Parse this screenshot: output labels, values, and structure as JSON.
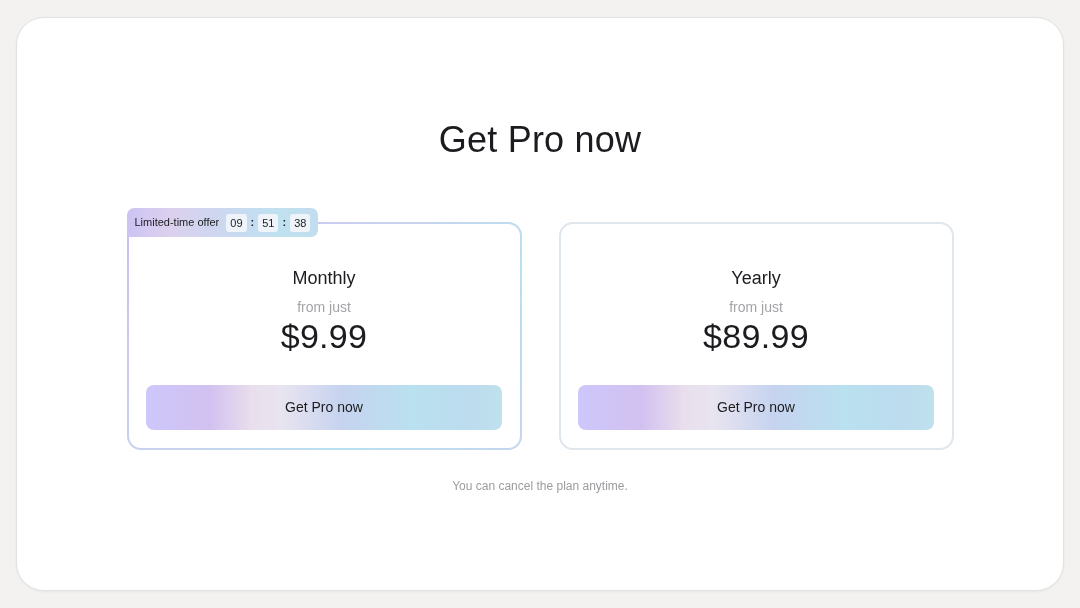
{
  "title": "Get Pro now",
  "plans": [
    {
      "name": "Monthly",
      "caption": "from just",
      "price": "$9.99",
      "button": "Get Pro now",
      "selected": true,
      "offer": {
        "label": "Limited-time offer",
        "countdown": [
          {
            "kind": "unit",
            "text": "09"
          },
          {
            "kind": "separator",
            "text": ":"
          },
          {
            "kind": "unit",
            "text": "51"
          },
          {
            "kind": "separator",
            "text": ":"
          },
          {
            "kind": "unit",
            "text": "38"
          }
        ]
      }
    },
    {
      "name": "Yearly",
      "caption": "from just",
      "price": "$89.99",
      "button": "Get Pro now",
      "selected": false
    }
  ],
  "note": "You can cancel the plan anytime."
}
